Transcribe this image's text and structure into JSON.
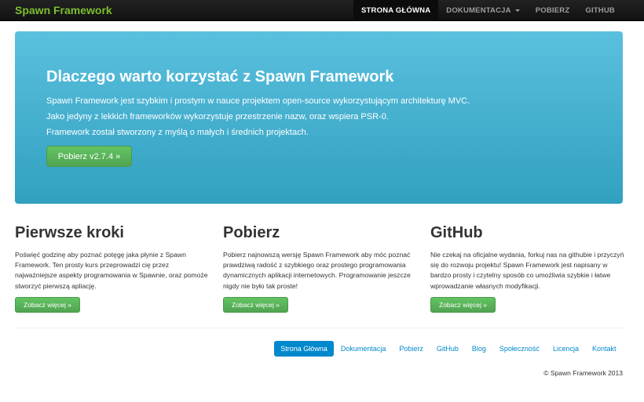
{
  "navbar": {
    "brand": "Spawn Framework",
    "items": [
      {
        "label": "STRONA GŁÓWNA",
        "active": true
      },
      {
        "label": "DOKUMENTACJA",
        "dropdown": true
      },
      {
        "label": "POBIERZ"
      },
      {
        "label": "GITHUB"
      }
    ]
  },
  "hero": {
    "title": "Dlaczego warto korzystać z Spawn Framework",
    "lines": [
      "Spawn Framework jest szybkim i prostym w nauce projektem open-source wykorzystującym architekturę MVC.",
      "Jako jedyny z lekkich frameworków wykorzystuje przestrzenie nazw, oraz wspiera PSR-0.",
      "Framework został stworzony z myślą o małych i średnich projektach."
    ],
    "button": "Pobierz v2.7.4 »"
  },
  "columns": [
    {
      "title": "Pierwsze kroki",
      "text": "Poświęć godzinę aby poznać potęgę jaka płynie z Spawn Framework. Ten prosty kurs przeprowadzi cię przez najważniejsze aspekty programowania w Spawnie, oraz pomoże stworzyć pierwszą apliację.",
      "button": "Zobacz więcej »"
    },
    {
      "title": "Pobierz",
      "text": "Pobierz najnowszą wersję Spawn Framework aby móc poznać prawdziwą radość z szybkiego oraz prostego programowania dynamicznych aplikacji internetowych. Programowanie jeszcze nigdy nie było tak proste!",
      "button": "Zobacz więcej »"
    },
    {
      "title": "GitHub",
      "text": "Nie czekaj na oficjalne wydania, forkuj nas na githubie i przyczyń się do rozwoju projektu! Spawn Framework jest napisany w bardzo prosty i czytelny sposób co umożliwia szybkie i łatwe wprowadzanie własnych modyfikacji.",
      "button": "Zobacz więcej »"
    }
  ],
  "footer": {
    "nav": [
      {
        "label": "Strona Główna",
        "active": true
      },
      {
        "label": "Dokumentacja"
      },
      {
        "label": "Pobierz"
      },
      {
        "label": "GitHub"
      },
      {
        "label": "Blog"
      },
      {
        "label": "Społeczność"
      },
      {
        "label": "Licencja"
      },
      {
        "label": "Kontakt"
      }
    ],
    "copyright": "© Spawn Framework 2013"
  },
  "colors": {
    "brand": "#7cbf2f",
    "hero": "#5bc0de",
    "button": "#5bb75b",
    "link": "#0088cc"
  }
}
